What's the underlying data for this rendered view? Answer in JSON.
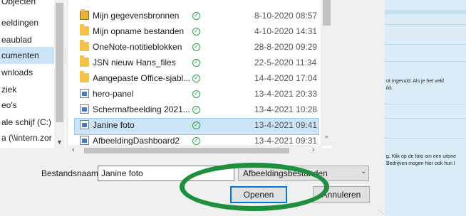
{
  "nav": {
    "items": [
      {
        "label": "Objecten"
      },
      {
        "label": "eeldingen"
      },
      {
        "label": "eaublad"
      },
      {
        "label": "cumenten"
      },
      {
        "label": "wnloads"
      },
      {
        "label": "ziek"
      },
      {
        "label": "eo's"
      },
      {
        "label": "ale schijf (C:)"
      },
      {
        "label": "a (\\\\intern.zor"
      }
    ],
    "selected_index": 3
  },
  "files": [
    {
      "name": "Mijn gegevensbronnen",
      "date": "8-10-2020 08:57",
      "icon": "folder-open-icon"
    },
    {
      "name": "Mijn opname bestanden",
      "date": "4-10-2020 14:31",
      "icon": "folder-icon"
    },
    {
      "name": "OneNote-notitieblokken",
      "date": "28-8-2020 09:29",
      "icon": "folder-icon"
    },
    {
      "name": "JSN nieuw Hans_files",
      "date": "22-5-2020 11:34",
      "icon": "folder-icon"
    },
    {
      "name": "Aangepaste Office-sjabl...",
      "date": "14-4-2020 17:04",
      "icon": "folder-icon"
    },
    {
      "name": "hero-panel",
      "date": "13-4-2021 20:33",
      "icon": "image-file-icon"
    },
    {
      "name": "Schermafbeelding 2021...",
      "date": "13-4-2021 10:28",
      "icon": "image-file-icon"
    },
    {
      "name": "Janine foto",
      "date": "13-4-2021 09:41",
      "icon": "image-file-icon"
    },
    {
      "name": "AfbeeldingDashboard2",
      "date": "13-4-2021 09:31",
      "icon": "image-file-icon"
    }
  ],
  "selected_file_index": 7,
  "sync_status_icon": "sync-ok-check-icon",
  "filename": {
    "label": "Bestandsnaam:",
    "value": "Janine foto"
  },
  "filter": {
    "value": "Afbeeldingsbestanden"
  },
  "buttons": {
    "open": "Openen",
    "cancel": "Annuleren"
  },
  "background": {
    "text1": "ot ingevuld. Als je het veld",
    "text2": "ild.",
    "text3": "g. Klik op de foto om een uitsne",
    "text4": "Bedrijven mogen hier ook hun l"
  },
  "colors": {
    "accent": "#0078d7",
    "selection": "#cce4f7",
    "highlight_oval": "#1e8f3c",
    "sync_check": "#2f9e44"
  }
}
